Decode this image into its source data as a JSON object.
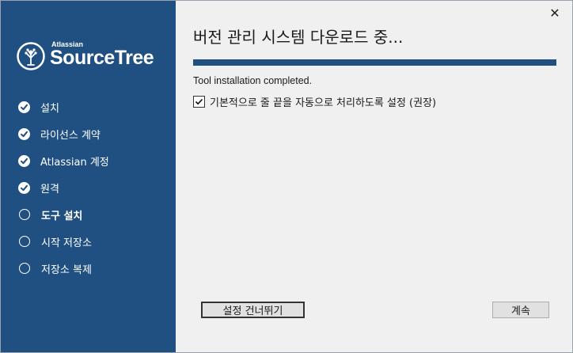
{
  "brand": {
    "company": "Atlassian",
    "product": "SourceTree"
  },
  "steps": [
    {
      "label": "설치",
      "state": "done"
    },
    {
      "label": "라이선스 계약",
      "state": "done"
    },
    {
      "label": "Atlassian 계정",
      "state": "done"
    },
    {
      "label": "원격",
      "state": "done"
    },
    {
      "label": "도구 설치",
      "state": "current"
    },
    {
      "label": "시작 저장소",
      "state": "todo"
    },
    {
      "label": "저장소 복제",
      "state": "todo"
    }
  ],
  "main": {
    "title": "버전 관리 시스템 다운로드 중...",
    "progress": 1.0,
    "status": "Tool installation completed.",
    "checkbox_label": "기본적으로 줄 끝을 자동으로 처리하도록 설정 (권장)",
    "checkbox_checked": true
  },
  "buttons": {
    "skip": "설정 건너뛰기",
    "next": "계속",
    "close": "✕"
  },
  "colors": {
    "sidebar": "#205081",
    "progress": "#205081"
  }
}
